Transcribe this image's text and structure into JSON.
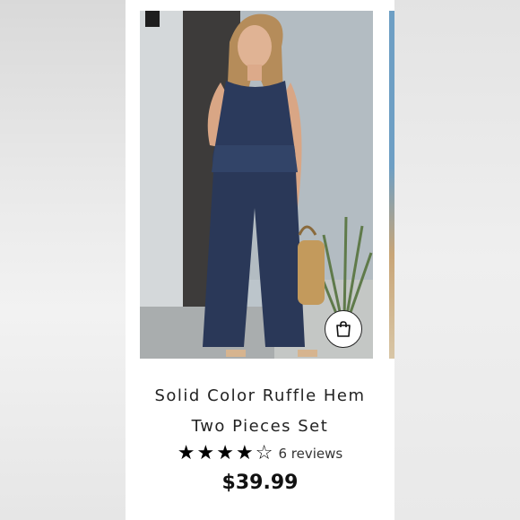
{
  "product": {
    "title_line1": "Solid Color Ruffle Hem",
    "title_line2": "Two Pieces Set",
    "rating": 4,
    "rating_max": 5,
    "reviews_label": "6 reviews",
    "price": "$39.99"
  },
  "icons": {
    "add_to_bag": "shopping-bag-icon",
    "star_filled": "★",
    "star_empty": "☆"
  },
  "colors": {
    "outfit": "#2b3a5c",
    "accent": "#111111"
  }
}
